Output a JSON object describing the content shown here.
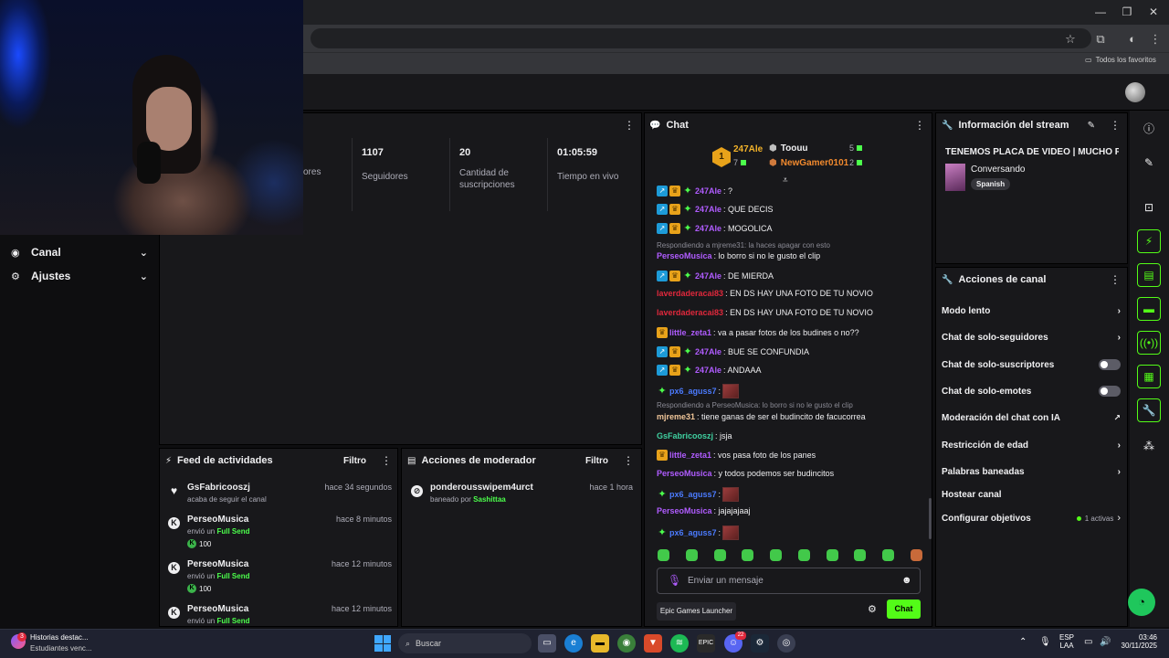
{
  "browser": {
    "bookmarks_label": "Todos los favoritos"
  },
  "sidebar": {
    "items": [
      {
        "label": "Canal",
        "icon": "broadcast-icon"
      },
      {
        "label": "Ajustes",
        "icon": "gear-icon"
      }
    ]
  },
  "stats": {
    "partial_label": "ores",
    "columns": [
      {
        "value": "1107",
        "label": "Seguidores"
      },
      {
        "value": "20",
        "label": "Cantidad de suscripciones"
      },
      {
        "value": "01:05:59",
        "label": "Tiempo en vivo"
      }
    ]
  },
  "activity": {
    "title": "Feed de actividades",
    "filter": "Filtro",
    "items": [
      {
        "name": "GsFabricooszj",
        "time": "hace 34 segundos",
        "sub": "acaba de seguir el canal",
        "amount": ""
      },
      {
        "name": "PerseoMusica",
        "time": "hace 8 minutos",
        "sub_prefix": "envió un",
        "sub_item": "Full Send",
        "amount": "100"
      },
      {
        "name": "PerseoMusica",
        "time": "hace 12 minutos",
        "sub_prefix": "envió un",
        "sub_item": "Full Send",
        "amount": "100"
      },
      {
        "name": "PerseoMusica",
        "time": "hace 12 minutos",
        "sub_prefix": "envió un",
        "sub_item": "Full Send",
        "amount": ""
      }
    ]
  },
  "modactions": {
    "title": "Acciones de moderador",
    "filter": "Filtro",
    "items": [
      {
        "name": "ponderousswipem4urct",
        "time": "hace 1 hora",
        "sub_prefix": "baneado por",
        "sub_by": "Sashittaa"
      }
    ]
  },
  "chat": {
    "title": "Chat",
    "leaderboard": {
      "first": {
        "rank": "1",
        "name": "247Ale",
        "count": "7"
      },
      "second": {
        "name": "Toouu",
        "count": "5"
      },
      "third": {
        "name": "NewGamer0101",
        "count": "2"
      }
    },
    "messages": [
      {
        "user": "247Ale",
        "text": ": ?",
        "badges": 3,
        "color": "#b05cff"
      },
      {
        "user": "247Ale",
        "text": ": QUE DECIS",
        "badges": 3,
        "color": "#b05cff"
      },
      {
        "user": "247Ale",
        "text": ": MOGOLICA",
        "badges": 3,
        "color": "#b05cff"
      },
      {
        "reply": "Respondiendo a mjreme31: la haces apagar con esto"
      },
      {
        "user": "PerseoMusica",
        "text": ": lo borro si no le gusto el clip",
        "badges": 0,
        "color": "#b05cff"
      },
      {
        "user": "247Ale",
        "text": ": DE MIERDA",
        "badges": 3,
        "color": "#b05cff"
      },
      {
        "user": "laverdaderacai83",
        "text": ": EN DS HAY UNA FOTO DE TU NOVIO",
        "badges": 0,
        "color": "#e0283c"
      },
      {
        "user": "laverdaderacai83",
        "text": ": EN DS HAY UNA FOTO DE TU NOVIO",
        "badges": 0,
        "color": "#e0283c"
      },
      {
        "user": "little_zeta1",
        "text": ": va a pasar fotos de los budines o no??",
        "badges": 1,
        "color": "#b05cff"
      },
      {
        "user": "247Ale",
        "text": ": BUE SE CONFUNDIA",
        "badges": 3,
        "color": "#b05cff"
      },
      {
        "user": "247Ale",
        "text": ": ANDAAA",
        "badges": 3,
        "color": "#b05cff"
      },
      {
        "user": "px6_aguss7",
        "text": ":",
        "badges": 9,
        "color": "#4b7bff",
        "emote": true
      },
      {
        "reply": "Respondiendo a PerseoMusica: lo borro si no le gusto el clip"
      },
      {
        "user": "mjreme31",
        "text": ": tiene ganas de ser el budincito de facucorrea",
        "badges": 0,
        "color": "#f2c79a"
      },
      {
        "user": "GsFabricooszj",
        "text": ": jsja",
        "badges": 0,
        "color": "#3fd0a0"
      },
      {
        "user": "little_zeta1",
        "text": ": vos pasa foto de los panes",
        "badges": 1,
        "color": "#b05cff"
      },
      {
        "user": "PerseoMusica",
        "text": ": y todos podemos ser budincitos",
        "badges": 0,
        "color": "#b05cff"
      },
      {
        "user": "px6_aguss7",
        "text": ":",
        "badges": 9,
        "color": "#4b7bff",
        "emote": true
      },
      {
        "user": "PerseoMusica",
        "text": ": jajajajaaj",
        "badges": 0,
        "color": "#b05cff"
      },
      {
        "user": "px6_aguss7",
        "text": ":",
        "badges": 9,
        "color": "#4b7bff",
        "emote": true
      }
    ],
    "input_placeholder": "Enviar un mensaje",
    "send_label": "Chat",
    "source_label": "Epic Games Launcher"
  },
  "streaminfo": {
    "title": "Información del stream",
    "stream_title": "TENEMOS PLACA DE VIDEO | MUCHO FN",
    "category": "Conversando",
    "language": "Spanish"
  },
  "channelactions": {
    "title": "Acciones de canal",
    "rows": [
      {
        "label": "Modo lento",
        "control": "chevron"
      },
      {
        "label": "Chat de solo-seguidores",
        "control": "chevron"
      },
      {
        "label": "Chat de solo-suscriptores",
        "control": "toggle"
      },
      {
        "label": "Chat de solo-emotes",
        "control": "toggle"
      },
      {
        "label": "Moderación del chat con IA",
        "control": "external"
      },
      {
        "label": "Restricción de edad",
        "control": "chevron"
      },
      {
        "label": "Palabras baneadas",
        "control": "chevron"
      },
      {
        "label": "Hostear canal",
        "control": "none"
      },
      {
        "label": "Configurar objetivos",
        "control": "chevron",
        "extra": "1 activas"
      }
    ]
  },
  "taskbar": {
    "notification_title": "Historias destac...",
    "notification_sub": "Estudiantes venc...",
    "notification_badge": "3",
    "search_label": "Buscar",
    "lang_top": "ESP",
    "lang_bottom": "LAA",
    "time": "03:46",
    "date": "30/11/2025",
    "discord_badge": "22"
  },
  "colors": {
    "accent": "#53fc18",
    "panel": "#18181b",
    "background": "#0e0e10"
  }
}
